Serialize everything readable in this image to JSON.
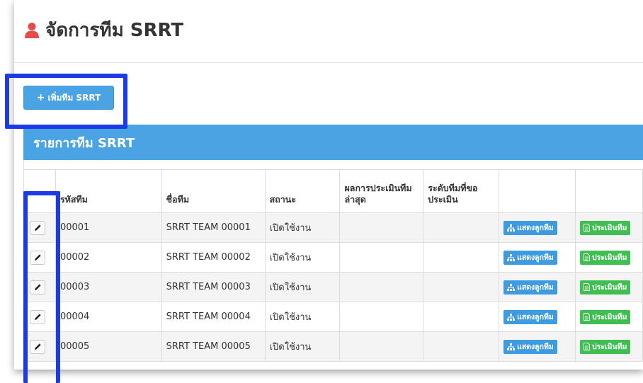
{
  "page": {
    "title": "จัดการทีม SRRT"
  },
  "toolbar": {
    "add_label": "เพิ่มทีม SRRT"
  },
  "panel": {
    "heading": "รายการทีม SRRT"
  },
  "table": {
    "headers": [
      "",
      "รหัสทีม",
      "ชื่อทีม",
      "สถานะ",
      "ผลการประเมินทีมล่าสุด",
      "ระดับทีมที่ขอประเมิน",
      "",
      ""
    ],
    "rows": [
      {
        "code": "00001",
        "name": "SRRT TEAM 00001",
        "status": "เปิดใช้งาน",
        "latest_result": "",
        "requested_level": ""
      },
      {
        "code": "00002",
        "name": "SRRT TEAM 00002",
        "status": "เปิดใช้งาน",
        "latest_result": "",
        "requested_level": ""
      },
      {
        "code": "00003",
        "name": "SRRT TEAM 00003",
        "status": "เปิดใช้งาน",
        "latest_result": "",
        "requested_level": ""
      },
      {
        "code": "00004",
        "name": "SRRT TEAM 00004",
        "status": "เปิดใช้งาน",
        "latest_result": "",
        "requested_level": ""
      },
      {
        "code": "00005",
        "name": "SRRT TEAM 00005",
        "status": "เปิดใช้งาน",
        "latest_result": "",
        "requested_level": ""
      }
    ],
    "actions": {
      "show_members": "แสดงลูกทีม",
      "evaluate": "ประเมินทีม"
    }
  },
  "icons": {
    "title": "user-icon",
    "add": "plus-icon",
    "edit": "pencil-icon",
    "members": "sitemap-icon",
    "evaluate": "document-icon"
  },
  "colors": {
    "primary": "#4aa3e3",
    "success": "#3fbf52",
    "title_icon": "#e74c4c",
    "highlight": "#1a3be6"
  }
}
